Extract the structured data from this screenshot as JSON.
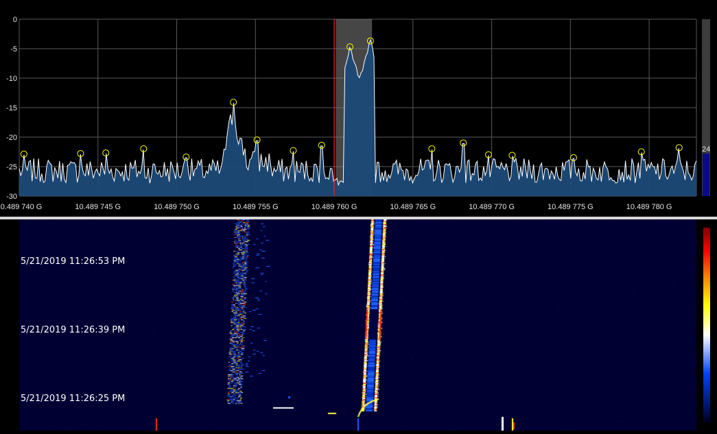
{
  "chart_data": {
    "type": "line",
    "yaxis": {
      "ylim": [
        -30,
        0
      ],
      "ticks": [
        "0",
        "-5",
        "-10",
        "-15",
        "-20",
        "-25",
        "-30"
      ]
    },
    "xaxis": {
      "xlim_offset_hz": [
        740,
        783
      ],
      "tick_labels": [
        "10.489 740 G",
        "10.489 745 G",
        "10.489 750 G",
        "10.489 755 G",
        "10.489 760 G",
        "10.489 765 G",
        "10.489 770 G",
        "10.489 775 G",
        "10.489 780 G"
      ],
      "tick_values": [
        740,
        745,
        750,
        755,
        760,
        765,
        770,
        775,
        780
      ]
    },
    "noise_floor": -25.5,
    "tuned_marker": 760.0,
    "filter_band": [
      760.1,
      762.4
    ],
    "peaks": [
      [
        740.3,
        -23.0
      ],
      [
        743.9,
        -22.9
      ],
      [
        745.5,
        -22.8
      ],
      [
        747.9,
        -22.1
      ],
      [
        750.6,
        -23.5
      ],
      [
        753.6,
        -14.2
      ],
      [
        755.1,
        -20.6
      ],
      [
        757.4,
        -22.4
      ],
      [
        759.2,
        -21.5
      ],
      [
        761.0,
        -4.8
      ],
      [
        762.3,
        -3.8
      ],
      [
        766.2,
        -22.1
      ],
      [
        768.2,
        -21.1
      ],
      [
        769.8,
        -23.1
      ],
      [
        771.3,
        -23.2
      ],
      [
        775.2,
        -23.6
      ],
      [
        779.5,
        -22.6
      ],
      [
        781.9,
        -21.9
      ]
    ],
    "grid": true
  },
  "level_meter": {
    "value_label": "24"
  },
  "waterfall": {
    "timestamps": [
      "5/21/2019 11:26:53 PM",
      "5/21/2019 11:26:39 PM",
      "5/21/2019 11:26:25 PM"
    ],
    "colormap": [
      "#0000a0",
      "#0040ff",
      "#ffffff",
      "#ffff00",
      "#ff8000",
      "#ff0000",
      "#800000"
    ]
  },
  "colors": {
    "trace": "#ffffff",
    "fill": "#1c4a78",
    "grid": "#5a5a5a",
    "peak_marker": "#ffff00",
    "tuned_marker": "#ff2020",
    "band": "#808080",
    "waterfall_bg": "#000033"
  }
}
